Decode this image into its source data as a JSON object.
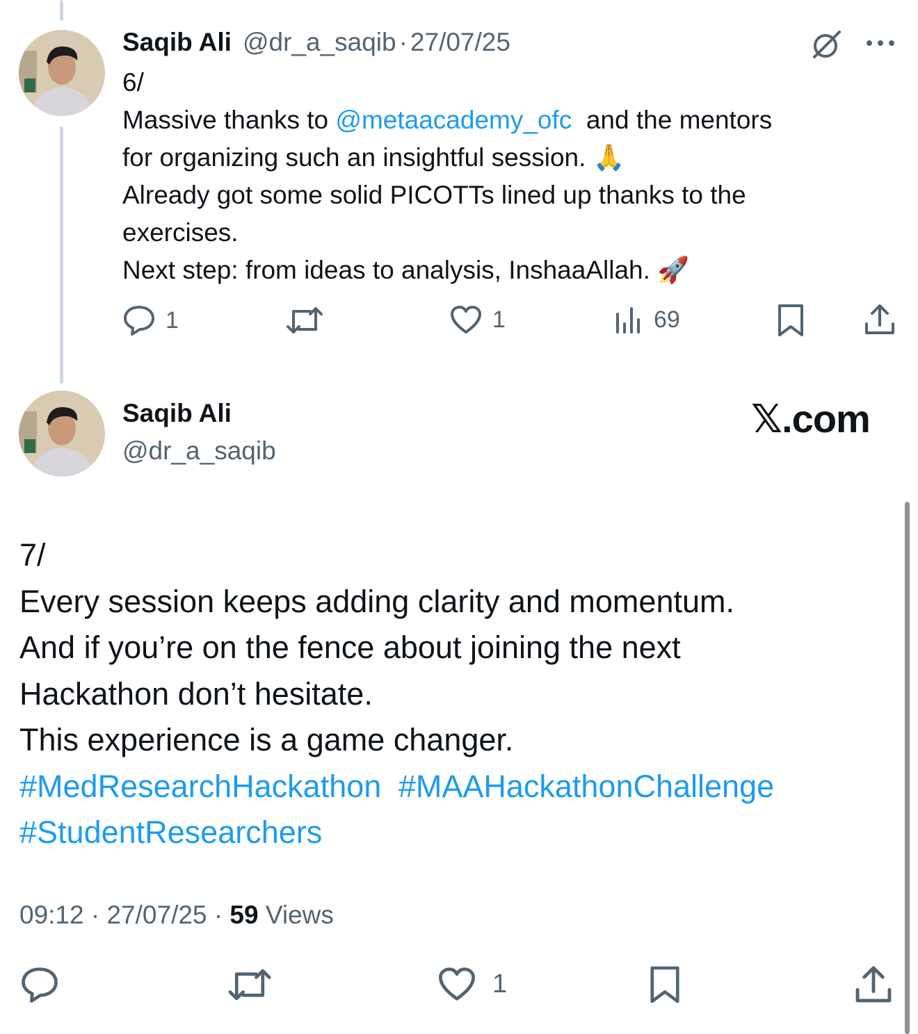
{
  "tweet1": {
    "author_name": "Saqib Ali",
    "handle": "@dr_a_saqib",
    "separator": "·",
    "date": "27/07/25",
    "more_label": "···",
    "text": {
      "line1": "6/",
      "line2_prefix": "Massive thanks to ",
      "line2_mention": "@metaacademy_ofc",
      "line2_suffix": "  and the mentors",
      "line3": "for organizing such an insightful session. 🙏",
      "line4": "Already got some solid PICOTTs lined up thanks to the",
      "line5": "exercises.",
      "line6": "Next step: from ideas to analysis, InshaaAllah. 🚀"
    },
    "actions": {
      "reply_count": "1",
      "retweet_count": "",
      "like_count": "1",
      "views_count": "69"
    }
  },
  "tweet2": {
    "author_name": "Saqib Ali",
    "handle": "@dr_a_saqib",
    "brand": "𝕏.com",
    "text": {
      "line1": "7/",
      "line2": "Every session keeps adding clarity and momentum.",
      "line3": "And if you’re on the fence about joining the next",
      "line4": "Hackathon don’t hesitate.",
      "line5": "This experience is a game changer.",
      "hashtag1": "#MedResearchHackathon",
      "hashtag2": "#MAAHackathonChallenge",
      "hashtag3": "#StudentResearchers"
    },
    "meta": {
      "time": "09:12",
      "separator": "·",
      "date": "27/07/25",
      "views_count": "59",
      "views_label": "Views"
    },
    "actions": {
      "like_count": "1"
    }
  },
  "colors": {
    "text": "#0f1419",
    "secondary": "#536471",
    "link": "#1d9bf0",
    "thread_line": "#cfd9de"
  },
  "icons": [
    "grok-icon",
    "reply-icon",
    "retweet-icon",
    "like-icon",
    "views-icon",
    "bookmark-icon",
    "share-icon"
  ]
}
